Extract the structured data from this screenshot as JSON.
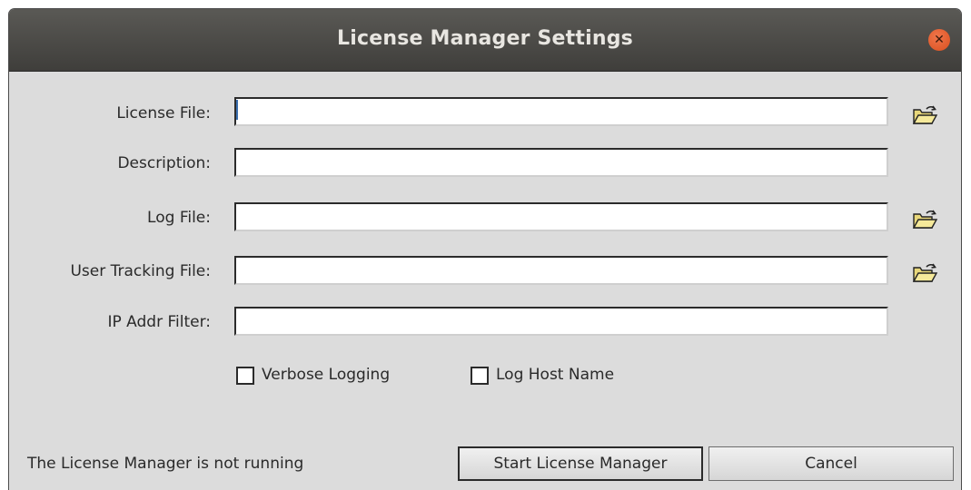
{
  "window": {
    "title": "License Manager Settings",
    "close_icon": "close-icon"
  },
  "form": {
    "license_file": {
      "label": "License File:",
      "value": "",
      "browse_icon": "folder-open-icon"
    },
    "description": {
      "label": "Description:",
      "value": ""
    },
    "log_file": {
      "label": "Log File:",
      "value": "",
      "browse_icon": "folder-open-icon"
    },
    "user_tracking_file": {
      "label": "User Tracking File:",
      "value": "",
      "browse_icon": "folder-open-icon"
    },
    "ip_addr_filter": {
      "label": "IP Addr Filter:",
      "value": ""
    }
  },
  "options": {
    "verbose_logging": {
      "label": "Verbose Logging",
      "checked": false
    },
    "log_host_name": {
      "label": "Log Host Name",
      "checked": false
    }
  },
  "footer": {
    "status_text": "The License Manager is not running",
    "start_button": "Start License Manager",
    "cancel_button": "Cancel"
  },
  "colors": {
    "titlebar": "#4a4946",
    "close_button": "#e3602f",
    "dialog_bg": "#dcdcdc"
  }
}
